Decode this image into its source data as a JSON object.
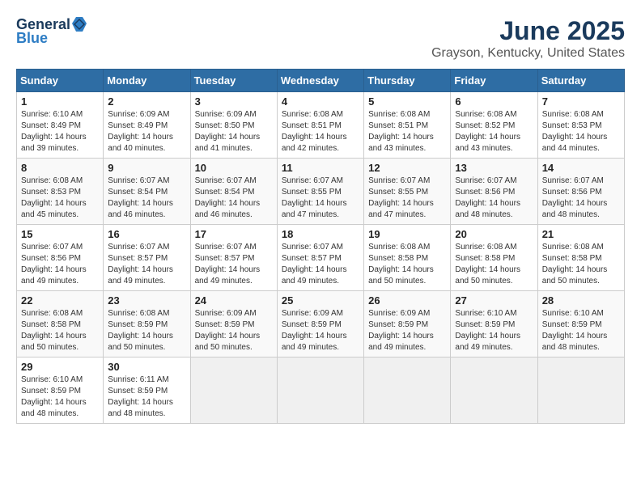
{
  "logo": {
    "general": "General",
    "blue": "Blue"
  },
  "title": "June 2025",
  "location": "Grayson, Kentucky, United States",
  "days": [
    "Sunday",
    "Monday",
    "Tuesday",
    "Wednesday",
    "Thursday",
    "Friday",
    "Saturday"
  ],
  "weeks": [
    [
      {
        "num": "1",
        "sunrise": "6:10 AM",
        "sunset": "8:49 PM",
        "daylight": "14 hours and 39 minutes."
      },
      {
        "num": "2",
        "sunrise": "6:09 AM",
        "sunset": "8:49 PM",
        "daylight": "14 hours and 40 minutes."
      },
      {
        "num": "3",
        "sunrise": "6:09 AM",
        "sunset": "8:50 PM",
        "daylight": "14 hours and 41 minutes."
      },
      {
        "num": "4",
        "sunrise": "6:08 AM",
        "sunset": "8:51 PM",
        "daylight": "14 hours and 42 minutes."
      },
      {
        "num": "5",
        "sunrise": "6:08 AM",
        "sunset": "8:51 PM",
        "daylight": "14 hours and 43 minutes."
      },
      {
        "num": "6",
        "sunrise": "6:08 AM",
        "sunset": "8:52 PM",
        "daylight": "14 hours and 43 minutes."
      },
      {
        "num": "7",
        "sunrise": "6:08 AM",
        "sunset": "8:53 PM",
        "daylight": "14 hours and 44 minutes."
      }
    ],
    [
      {
        "num": "8",
        "sunrise": "6:08 AM",
        "sunset": "8:53 PM",
        "daylight": "14 hours and 45 minutes."
      },
      {
        "num": "9",
        "sunrise": "6:07 AM",
        "sunset": "8:54 PM",
        "daylight": "14 hours and 46 minutes."
      },
      {
        "num": "10",
        "sunrise": "6:07 AM",
        "sunset": "8:54 PM",
        "daylight": "14 hours and 46 minutes."
      },
      {
        "num": "11",
        "sunrise": "6:07 AM",
        "sunset": "8:55 PM",
        "daylight": "14 hours and 47 minutes."
      },
      {
        "num": "12",
        "sunrise": "6:07 AM",
        "sunset": "8:55 PM",
        "daylight": "14 hours and 47 minutes."
      },
      {
        "num": "13",
        "sunrise": "6:07 AM",
        "sunset": "8:56 PM",
        "daylight": "14 hours and 48 minutes."
      },
      {
        "num": "14",
        "sunrise": "6:07 AM",
        "sunset": "8:56 PM",
        "daylight": "14 hours and 48 minutes."
      }
    ],
    [
      {
        "num": "15",
        "sunrise": "6:07 AM",
        "sunset": "8:56 PM",
        "daylight": "14 hours and 49 minutes."
      },
      {
        "num": "16",
        "sunrise": "6:07 AM",
        "sunset": "8:57 PM",
        "daylight": "14 hours and 49 minutes."
      },
      {
        "num": "17",
        "sunrise": "6:07 AM",
        "sunset": "8:57 PM",
        "daylight": "14 hours and 49 minutes."
      },
      {
        "num": "18",
        "sunrise": "6:07 AM",
        "sunset": "8:57 PM",
        "daylight": "14 hours and 49 minutes."
      },
      {
        "num": "19",
        "sunrise": "6:08 AM",
        "sunset": "8:58 PM",
        "daylight": "14 hours and 50 minutes."
      },
      {
        "num": "20",
        "sunrise": "6:08 AM",
        "sunset": "8:58 PM",
        "daylight": "14 hours and 50 minutes."
      },
      {
        "num": "21",
        "sunrise": "6:08 AM",
        "sunset": "8:58 PM",
        "daylight": "14 hours and 50 minutes."
      }
    ],
    [
      {
        "num": "22",
        "sunrise": "6:08 AM",
        "sunset": "8:58 PM",
        "daylight": "14 hours and 50 minutes."
      },
      {
        "num": "23",
        "sunrise": "6:08 AM",
        "sunset": "8:59 PM",
        "daylight": "14 hours and 50 minutes."
      },
      {
        "num": "24",
        "sunrise": "6:09 AM",
        "sunset": "8:59 PM",
        "daylight": "14 hours and 50 minutes."
      },
      {
        "num": "25",
        "sunrise": "6:09 AM",
        "sunset": "8:59 PM",
        "daylight": "14 hours and 49 minutes."
      },
      {
        "num": "26",
        "sunrise": "6:09 AM",
        "sunset": "8:59 PM",
        "daylight": "14 hours and 49 minutes."
      },
      {
        "num": "27",
        "sunrise": "6:10 AM",
        "sunset": "8:59 PM",
        "daylight": "14 hours and 49 minutes."
      },
      {
        "num": "28",
        "sunrise": "6:10 AM",
        "sunset": "8:59 PM",
        "daylight": "14 hours and 48 minutes."
      }
    ],
    [
      {
        "num": "29",
        "sunrise": "6:10 AM",
        "sunset": "8:59 PM",
        "daylight": "14 hours and 48 minutes."
      },
      {
        "num": "30",
        "sunrise": "6:11 AM",
        "sunset": "8:59 PM",
        "daylight": "14 hours and 48 minutes."
      },
      null,
      null,
      null,
      null,
      null
    ]
  ]
}
